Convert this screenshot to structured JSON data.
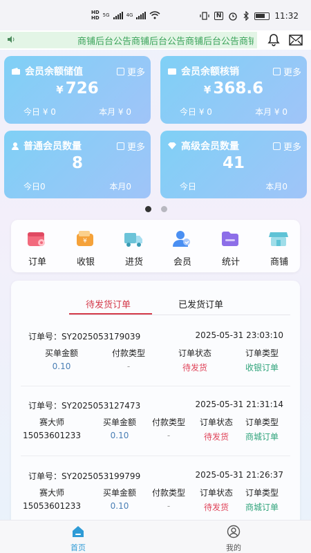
{
  "status_bar": {
    "hd1": "HD",
    "hd2": "HD",
    "net1": "5G",
    "net2": "4G",
    "nfc": "N",
    "time": "11:32"
  },
  "notice": {
    "text": "商铺后台公告商铺后台公告商铺后台公告商铺后台公告"
  },
  "cards": [
    {
      "title": "会员余额储值",
      "more": "更多",
      "currency": "¥",
      "value": "726",
      "today": "今日 ¥ 0",
      "month": "本月 ¥ 0"
    },
    {
      "title": "会员余额核销",
      "more": "更多",
      "currency": "¥",
      "value": "368.6",
      "today": "今日 ¥ 0",
      "month": "本月 ¥ 0"
    },
    {
      "title": "普通会员数量",
      "more": "更多",
      "currency": "",
      "value": "8",
      "today": "今日0",
      "month": "本月0"
    },
    {
      "title": "高级会员数量",
      "more": "更多",
      "currency": "",
      "value": "41",
      "today": "今日",
      "month": "本月0"
    }
  ],
  "carousel": {
    "pages": 2,
    "active": 0
  },
  "quick_menu": [
    {
      "label": "订单",
      "icon": "calendar-icon",
      "color": "#f26a7d"
    },
    {
      "label": "收银",
      "icon": "wallet-icon",
      "color": "#f5a23a"
    },
    {
      "label": "进货",
      "icon": "truck-icon",
      "color": "#6cc3d8"
    },
    {
      "label": "会员",
      "icon": "member-icon",
      "color": "#4a8ff2"
    },
    {
      "label": "统计",
      "icon": "folder-icon",
      "color": "#8d6ee8"
    },
    {
      "label": "商铺",
      "icon": "shop-icon",
      "color": "#5fc3d6"
    }
  ],
  "tabs": {
    "pending": "待发货订单",
    "shipped": "已发货订单"
  },
  "orders": [
    {
      "no": "订单号：SY2025053179039",
      "time": "2025-05-31 23:03:10",
      "buyer": "",
      "phone": "",
      "amount_h": "买单金额",
      "amount": "0.10",
      "pay_h": "付款类型",
      "pay": "-",
      "status_h": "订单状态",
      "status": "待发货",
      "type_h": "订单类型",
      "type": "收银订单"
    },
    {
      "no": "订单号：SY2025053127473",
      "time": "2025-05-31 21:31:14",
      "buyer": "赛大师",
      "phone": "15053601233",
      "amount_h": "买单金额",
      "amount": "0.10",
      "pay_h": "付款类型",
      "pay": "-",
      "status_h": "订单状态",
      "status": "待发货",
      "type_h": "订单类型",
      "type": "商城订单"
    },
    {
      "no": "订单号：SY2025053199799",
      "time": "2025-05-31 21:26:37",
      "buyer": "赛大师",
      "phone": "15053601233",
      "amount_h": "买单金额",
      "amount": "0.10",
      "pay_h": "付款类型",
      "pay": "-",
      "status_h": "订单状态",
      "status": "待发货",
      "type_h": "订单类型",
      "type": "商城订单"
    }
  ],
  "bottom_nav": {
    "home": "首页",
    "mine": "我的",
    "active_color": "#2e9bd6"
  }
}
